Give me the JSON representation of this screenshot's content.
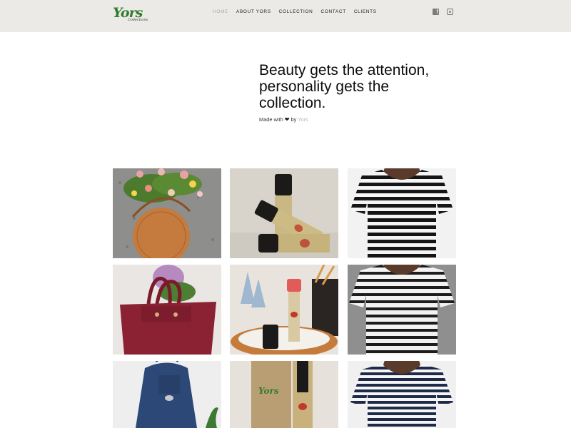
{
  "header": {
    "logo": {
      "text": "Yors",
      "sub": "Collections"
    },
    "nav": [
      {
        "label": "HOME",
        "active": true
      },
      {
        "label": "ABOUT YORS",
        "active": false
      },
      {
        "label": "COLLECTION",
        "active": false
      },
      {
        "label": "CONTACT",
        "active": false
      },
      {
        "label": "CLIENTS",
        "active": false
      }
    ],
    "social": [
      "facebook-icon",
      "instagram-icon"
    ]
  },
  "hero": {
    "title": "Beauty gets the attention, personality gets the collection.",
    "made_with_prefix": "Made with",
    "made_with_by": "by",
    "brand": "Yors"
  },
  "gallery": [
    "tan-round-bag-with-flowers",
    "lip-cheek-tint-rollers",
    "black-white-striped-tee",
    "burgundy-leather-tote",
    "tint-bottle-on-rattan-tray",
    "black-white-striped-tee-2",
    "navy-drawstring-backpack",
    "lip-cheek-gel-tint-box",
    "navy-striped-tee"
  ],
  "colors": {
    "header_bg": "#ebeae7",
    "logo_green": "#2f7d2c",
    "brand_link": "#b5b5a8",
    "nav_active": "#a9a9a9"
  }
}
